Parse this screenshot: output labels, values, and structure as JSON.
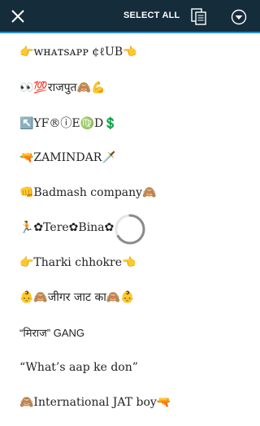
{
  "toolbar": {
    "close_icon": "close-icon",
    "select_all_label": "SELECT ALL",
    "copy_icon": "copy-icon",
    "menu_icon": "dropdown-circle-icon",
    "background": "#152c3b",
    "accent": "#2f8fd6"
  },
  "items": [
    {
      "text": "👉ᴡʜᴀᴛsᴀᴘᴘ ¢ℓUB👈"
    },
    {
      "text": "👀💯राजपुत🙈💪"
    },
    {
      "text": "↖️YF®ⓘE♍D💲"
    },
    {
      "text": "🔫ZAMINDAR🗡️"
    },
    {
      "text": "👊Badmash company🙈"
    },
    {
      "text": "🏃✿Tere✿Bina✿"
    },
    {
      "text": "👉Tharki chhokre👈"
    },
    {
      "text": "👶🙈जीगर जाट का🙈👶"
    },
    {
      "text": "“मिराज” GANG"
    },
    {
      "text": "“What’s aap ke don”"
    },
    {
      "text": "🙈International JAT boy🔫"
    }
  ],
  "loading_icon": "loading-spinner-icon"
}
